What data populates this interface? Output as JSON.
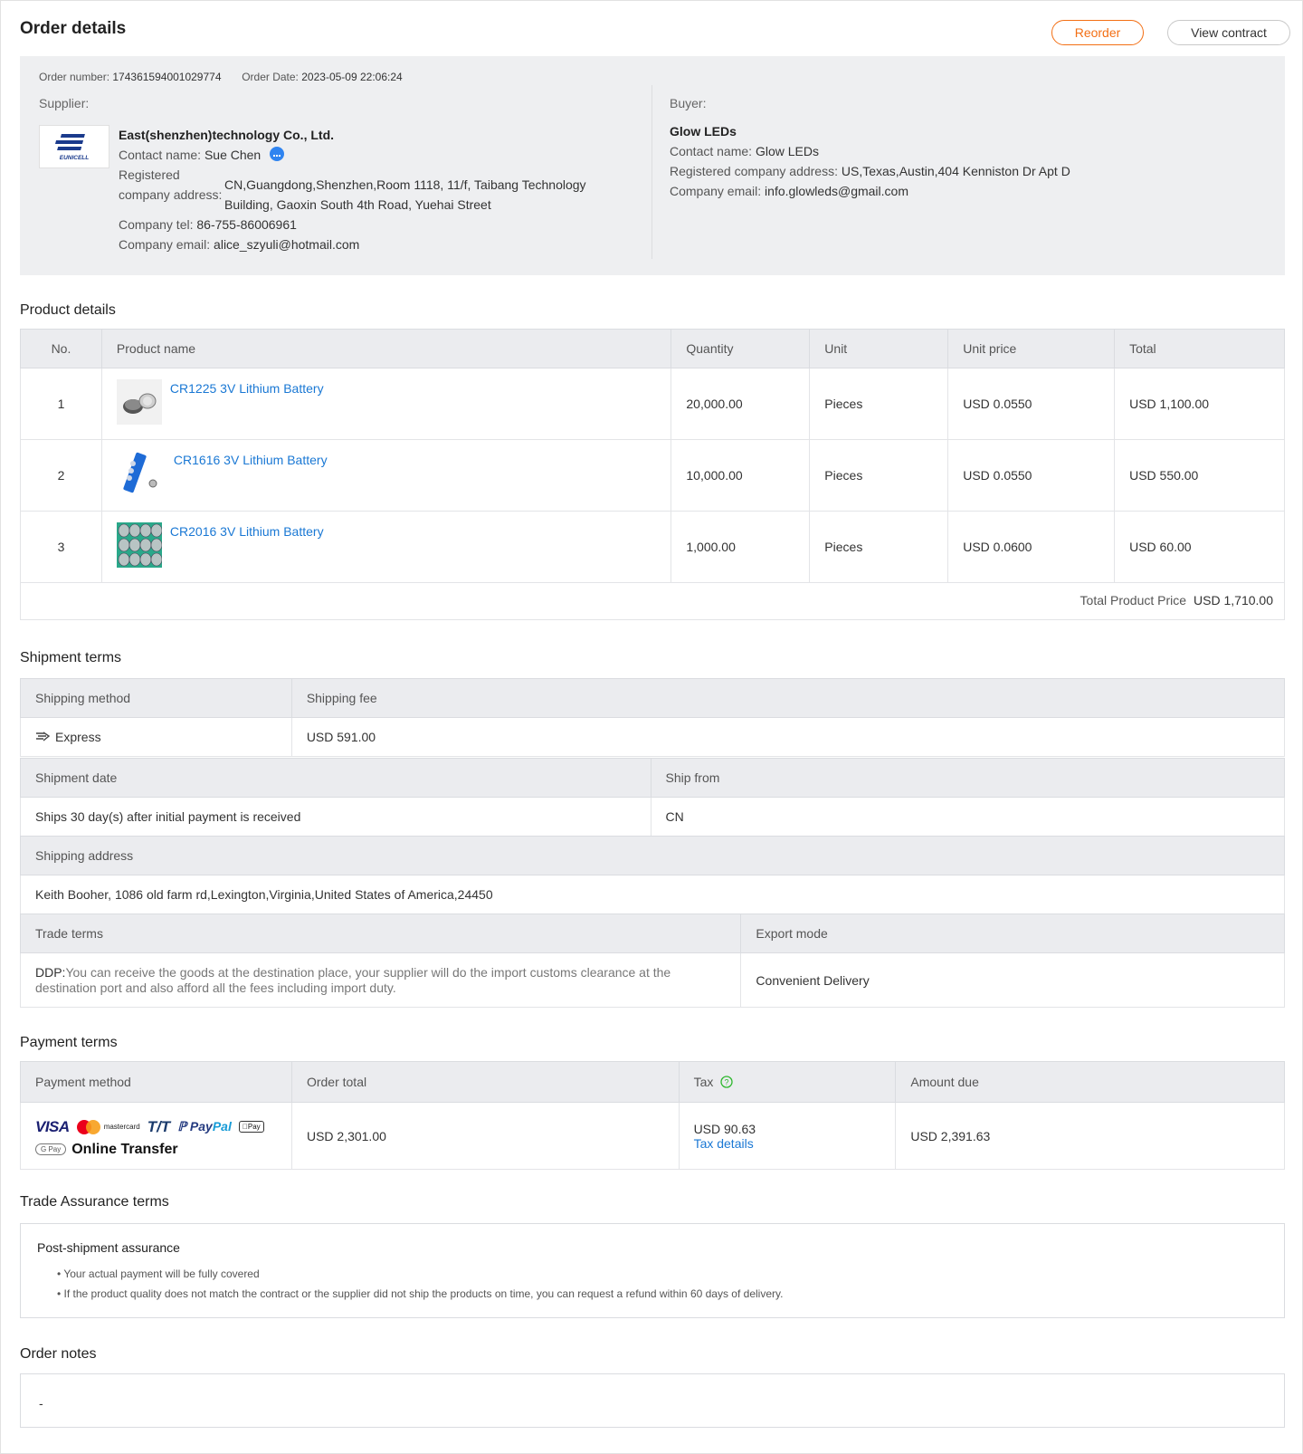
{
  "header": {
    "title": "Order details",
    "reorder_label": "Reorder",
    "contract_label": "View contract"
  },
  "order": {
    "number_label": "Order number:",
    "number": "174361594001029774",
    "date_label": "Order Date:",
    "date": "2023-05-09 22:06:24"
  },
  "supplier": {
    "section_label": "Supplier:",
    "logo_text": "EUNICELL",
    "name": "East(shenzhen)technology Co., Ltd.",
    "contact_label": "Contact name:",
    "contact": "Sue Chen",
    "address_label": "Registered company address:",
    "address": "CN,Guangdong,Shenzhen,Room 1118, 11/f, Taibang Technology Building, Gaoxin South 4th Road, Yuehai Street",
    "tel_label": "Company tel:",
    "tel": "86-755-86006961",
    "email_label": "Company email:",
    "email": "alice_szyuli@hotmail.com"
  },
  "buyer": {
    "section_label": "Buyer:",
    "name": "Glow LEDs",
    "contact_label": "Contact name:",
    "contact": "Glow LEDs",
    "address_label": "Registered company address:",
    "address": "US,Texas,Austin,404 Kenniston Dr Apt D",
    "email_label": "Company email:",
    "email": "info.glowleds@gmail.com"
  },
  "products": {
    "title": "Product details",
    "headers": [
      "No.",
      "Product name",
      "Quantity",
      "Unit",
      "Unit price",
      "Total"
    ],
    "rows": [
      {
        "no": "1",
        "name": "CR1225 3V Lithium Battery",
        "qty": "20,000.00",
        "unit": "Pieces",
        "price": "USD 0.0550",
        "total": "USD 1,100.00"
      },
      {
        "no": "2",
        "name": "CR1616 3V Lithium Battery",
        "qty": "10,000.00",
        "unit": "Pieces",
        "price": "USD 0.0550",
        "total": "USD 550.00"
      },
      {
        "no": "3",
        "name": "CR2016 3V Lithium Battery",
        "qty": "1,000.00",
        "unit": "Pieces",
        "price": "USD 0.0600",
        "total": "USD 60.00"
      }
    ],
    "total_label": "Total Product Price",
    "total_value": "USD 1,710.00"
  },
  "shipment": {
    "title": "Shipment terms",
    "method_label": "Shipping method",
    "fee_label": "Shipping fee",
    "method": "Express",
    "fee": "USD 591.00",
    "date_label": "Shipment date",
    "from_label": "Ship from",
    "date": "Ships 30 day(s) after initial payment is received",
    "from": "CN",
    "address_label": "Shipping address",
    "address": "Keith Booher, 1086 old farm rd,Lexington,Virginia,United States of America,24450",
    "trade_label": "Trade terms",
    "export_label": "Export mode",
    "trade_code": "DDP:",
    "trade_desc": "You can receive the goods at the destination place, your supplier will do the import customs clearance at the destination port and also afford all the fees including import duty.",
    "export": "Convenient Delivery"
  },
  "payment": {
    "title": "Payment terms",
    "headers": [
      "Payment method",
      "Order total",
      "Tax",
      "Amount due"
    ],
    "logos": {
      "visa": "VISA",
      "mastercard": "mastercard",
      "tt": "T/T",
      "paypal_a": "Pay",
      "paypal_b": "Pal",
      "applepay": "Pay",
      "gpay": "G Pay"
    },
    "online_transfer": "Online Transfer",
    "order_total": "USD 2,301.00",
    "tax": "USD 90.63",
    "tax_link": "Tax details",
    "amount_due": "USD 2,391.63"
  },
  "assurance": {
    "title": "Trade Assurance terms",
    "heading": "Post-shipment assurance",
    "bullets": [
      "• Your actual payment will be fully covered",
      "• If the product quality does not match the contract or the supplier did not ship the products on time, you can request a refund within 60 days of delivery."
    ]
  },
  "notes": {
    "title": "Order notes",
    "value": "-"
  },
  "colors": {
    "accent": "#f36f14",
    "link": "#1a78d4",
    "header_bg": "#ebecef",
    "info_bg": "#eeeff1"
  }
}
